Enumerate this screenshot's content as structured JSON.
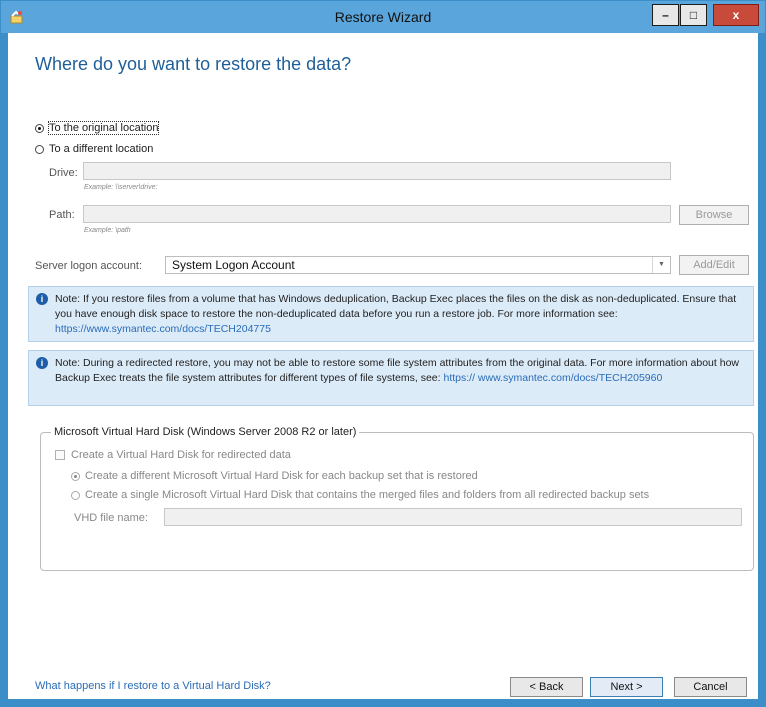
{
  "window": {
    "title": "Restore Wizard",
    "controls": {
      "minimize": "–",
      "maximize": "□",
      "close": "x"
    }
  },
  "heading": "Where do you want to restore the data?",
  "location": {
    "original_label": "To the original location",
    "different_label": "To a different location",
    "selected": "original",
    "drive": {
      "label": "Drive:",
      "value": "",
      "example": "Example: \\\\server\\drive:"
    },
    "path": {
      "label": "Path:",
      "value": "",
      "example": "Example: \\path",
      "browse_label": "Browse"
    },
    "logon": {
      "label": "Server logon account:",
      "value": "System Logon Account",
      "add_edit_label": "Add/Edit"
    }
  },
  "notes": [
    {
      "text": "Note: If you restore files from a volume that has Windows deduplication, Backup Exec places the files on the disk as non-deduplicated. Ensure that you have enough disk space to restore the non-deduplicated data before you run a restore job. For more information see: ",
      "link": "https://www.symantec.com/docs/TECH204775"
    },
    {
      "text": "Note: During a redirected restore, you may not be able to restore some file system attributes from the original data. For more information about how Backup Exec treats the file system attributes for different types of file systems, see: ",
      "link": "https://\nwww.symantec.com/docs/TECH205960"
    }
  ],
  "vhd": {
    "group_title": "Microsoft Virtual Hard Disk (Windows Server 2008 R2 or later)",
    "create_checkbox_label": "Create a Virtual Hard Disk for redirected data",
    "option_each": "Create a different Microsoft Virtual Hard Disk for each backup set that is restored",
    "option_single": "Create a single Microsoft Virtual Hard Disk that contains the merged files and folders from all redirected backup sets",
    "file_name_label": "VHD file name:",
    "file_name_value": ""
  },
  "footer": {
    "help_link": "What happens if I restore to a Virtual Hard Disk?",
    "back_label": "< Back",
    "next_label": "Next >",
    "cancel_label": "Cancel"
  }
}
